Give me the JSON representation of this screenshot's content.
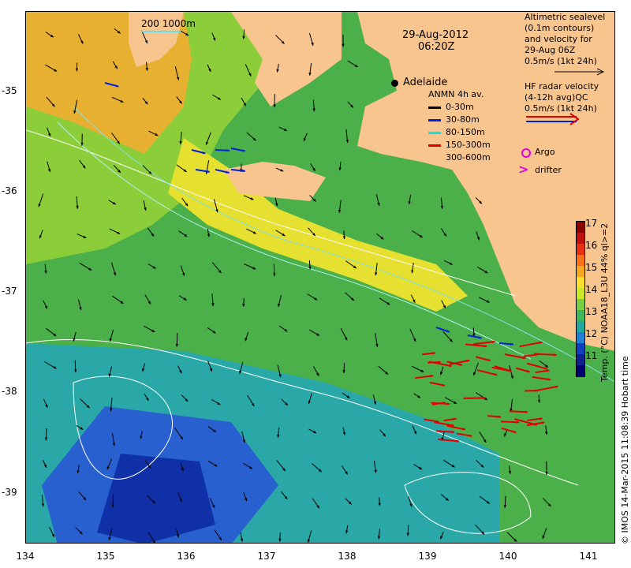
{
  "title": {
    "date": "29-Aug-2012",
    "time": "06:20Z"
  },
  "scale_bar": {
    "label": "200  1000m"
  },
  "city": {
    "name": "Adelaide"
  },
  "altimetry": {
    "lines": [
      "Altimetric sealevel",
      "(0.1m contours)",
      "and velocity for",
      "29-Aug 06Z",
      "0.5m/s (1kt 24h)"
    ]
  },
  "hf_radar": {
    "lines": [
      "HF radar velocity",
      "(4-12h avg)QC",
      "0.5m/s (1kt 24h)"
    ]
  },
  "anmn": {
    "title": "ANMN 4h av.",
    "items": [
      {
        "label": "0-30m",
        "color": "#000000"
      },
      {
        "label": "30-80m",
        "color": "#0020e0"
      },
      {
        "label": "80-150m",
        "color": "#00e8f0"
      },
      {
        "label": "150-300m",
        "color": "#e00000"
      },
      {
        "label": "300-600m",
        "color": "#000000"
      }
    ]
  },
  "markers": {
    "argo": "Argo",
    "drifter": "drifter",
    "argo_color": "#e000e0"
  },
  "x_ticks": [
    "134",
    "135",
    "136",
    "137",
    "138",
    "139",
    "140",
    "141"
  ],
  "y_ticks": [
    "-35",
    "-36",
    "-37",
    "-38",
    "-39"
  ],
  "colorbar": {
    "ticks": [
      "17",
      "16",
      "15",
      "14",
      "13",
      "12",
      "11"
    ],
    "label": "Temp. (°C) NOAA18_L3U 44% ql>=2",
    "colors": [
      "#8b0000",
      "#c01010",
      "#e83010",
      "#f87018",
      "#f8a820",
      "#f8e030",
      "#c8e828",
      "#78d040",
      "#40b860",
      "#20a8a0",
      "#2080d8",
      "#1040c0",
      "#102090",
      "#000070"
    ]
  },
  "credit": "© IMOS 14-Mar-2015 11:08:39 Hobart time",
  "colors": {
    "land": "#f9c58f",
    "sea": "#4fb34a"
  }
}
